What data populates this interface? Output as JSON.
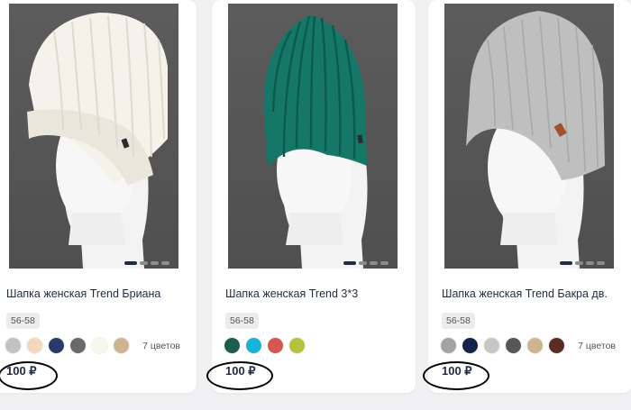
{
  "products": [
    {
      "title": "Шапка женская Trend Бриана",
      "size": "56-58",
      "swatches": [
        "#c2c2c2",
        "#f5d7bd",
        "#283a6b",
        "#6a6a6a",
        "#f7f7ef",
        "#cdb491"
      ],
      "colors_count": "7 цветов",
      "price": "100 ₽",
      "hat_color": "#f4f2ea",
      "hat_rib": "#dedbd0",
      "hat_style": "cuffed",
      "label_color": "#2b2b2b"
    },
    {
      "title": "Шапка женская Trend 3*3",
      "size": "56-58",
      "swatches": [
        "#1e5c4f",
        "#17b4d8",
        "#d9534f",
        "#b5c23a"
      ],
      "colors_count": "",
      "price": "100 ₽",
      "hat_color": "#147768",
      "hat_rib": "#0c5a4f",
      "hat_style": "tall",
      "label_color": "#2b2b2b"
    },
    {
      "title": "Шапка женская Trend Бакра дв.",
      "size": "56-58",
      "swatches": [
        "#a3a3a3",
        "#14234a",
        "#c7c7c7",
        "#575757",
        "#cdb48d",
        "#5a2d22"
      ],
      "colors_count": "7 цветов",
      "price": "100 ₽",
      "hat_color": "#bfbfbf",
      "hat_rib": "#a8a8a8",
      "hat_style": "slouch",
      "label_color": "#a0522d"
    }
  ]
}
